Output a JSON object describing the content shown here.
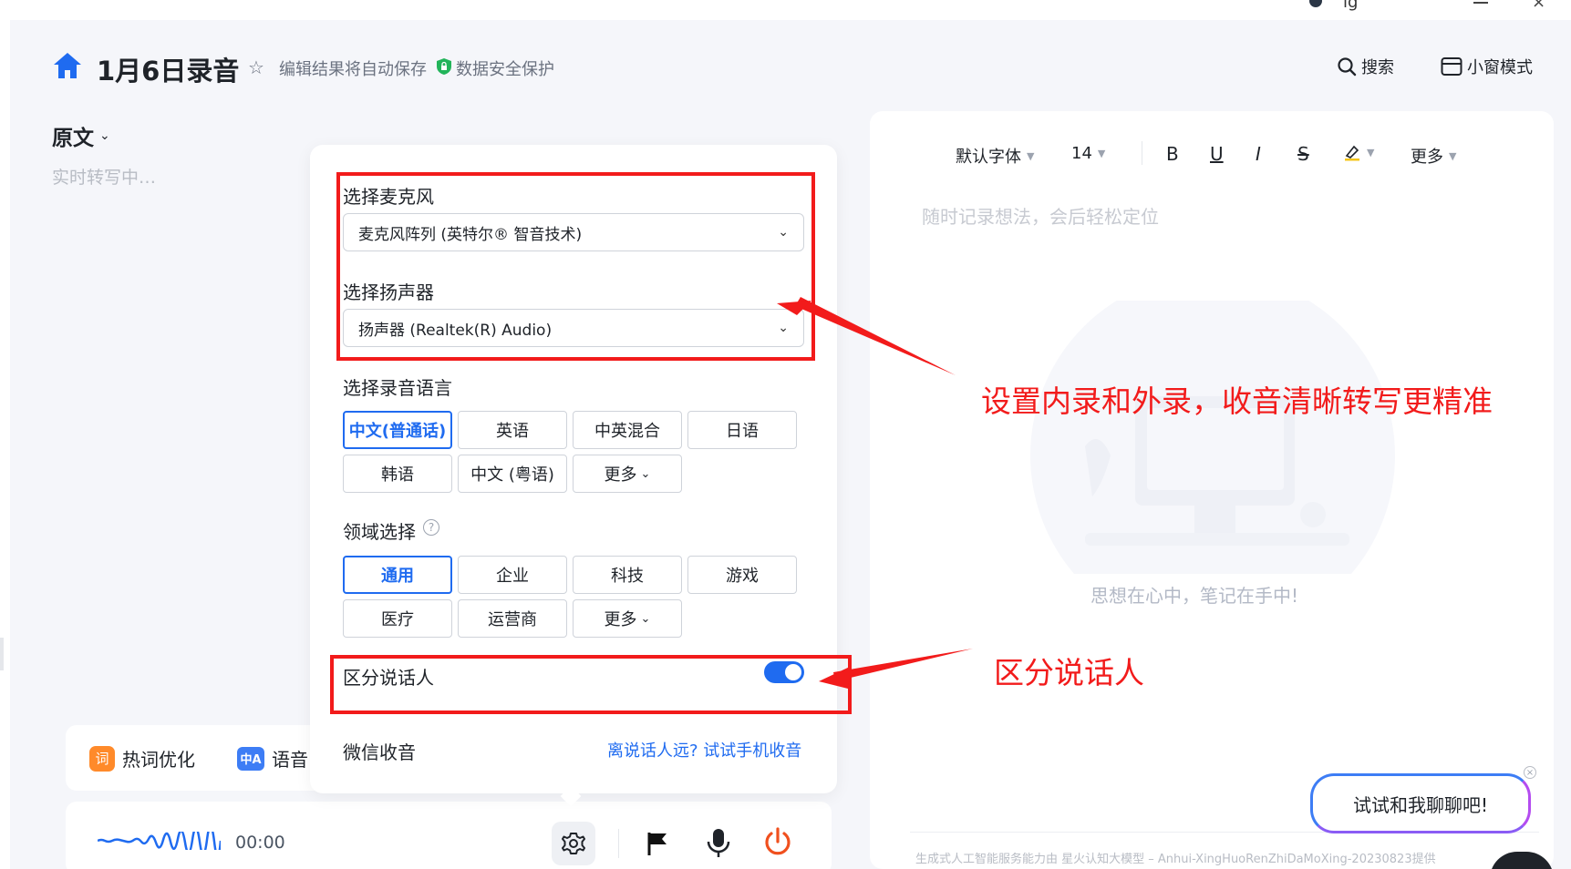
{
  "header": {
    "title": "1月6日录音",
    "autosave": "编辑结果将自动保存",
    "secure": "数据安全保护",
    "search_label": "搜索",
    "mini_label": "小窗模式",
    "top_partial_text": "ig"
  },
  "left": {
    "original_label": "原文",
    "transcribing_placeholder": "实时转写中…",
    "hotword_badge": "词",
    "hotword_label": "热词优化",
    "voice_badge": "中A",
    "voice_label": "语音",
    "timer": "00:00"
  },
  "settings": {
    "mic_label": "选择麦克风",
    "mic_value": "麦克风阵列 (英特尔® 智音技术)",
    "speaker_label": "选择扬声器",
    "speaker_value": "扬声器 (Realtek(R) Audio)",
    "language_label": "选择录音语言",
    "languages": [
      "中文(普通话)",
      "英语",
      "中英混合",
      "日语",
      "韩语",
      "中文 (粤语)",
      "更多"
    ],
    "domain_label": "领域选择",
    "domains": [
      "通用",
      "企业",
      "科技",
      "游戏",
      "医疗",
      "运营商",
      "更多"
    ],
    "speaker_diarization_label": "区分说话人",
    "speaker_diarization_on": true,
    "wechat_label": "微信收音",
    "wechat_link": "离说话人远? 试试手机收音"
  },
  "annotations": {
    "top": "设置内录和外录，收音清晰转写更精准",
    "bottom": "区分说话人"
  },
  "editor": {
    "font_label": "默认字体",
    "size_label": "14",
    "bold": "B",
    "underline": "U",
    "italic": "I",
    "strike": "S",
    "more_label": "更多",
    "placeholder": "随时记录想法，会后轻松定位",
    "slogan": "思想在心中，笔记在手中!",
    "footer": "生成式人工智能服务能力由 星火认知大模型 – Anhui-XingHuoRenZhiDaMoXing-20230823提供",
    "chat_prompt": "试试和我聊聊吧!"
  },
  "colors": {
    "accent": "#1f6bf0",
    "annotation_red": "#f21b1b",
    "home_blue": "#1f6bf0",
    "secure_green": "#22b45a",
    "power_red": "#f0501e"
  }
}
